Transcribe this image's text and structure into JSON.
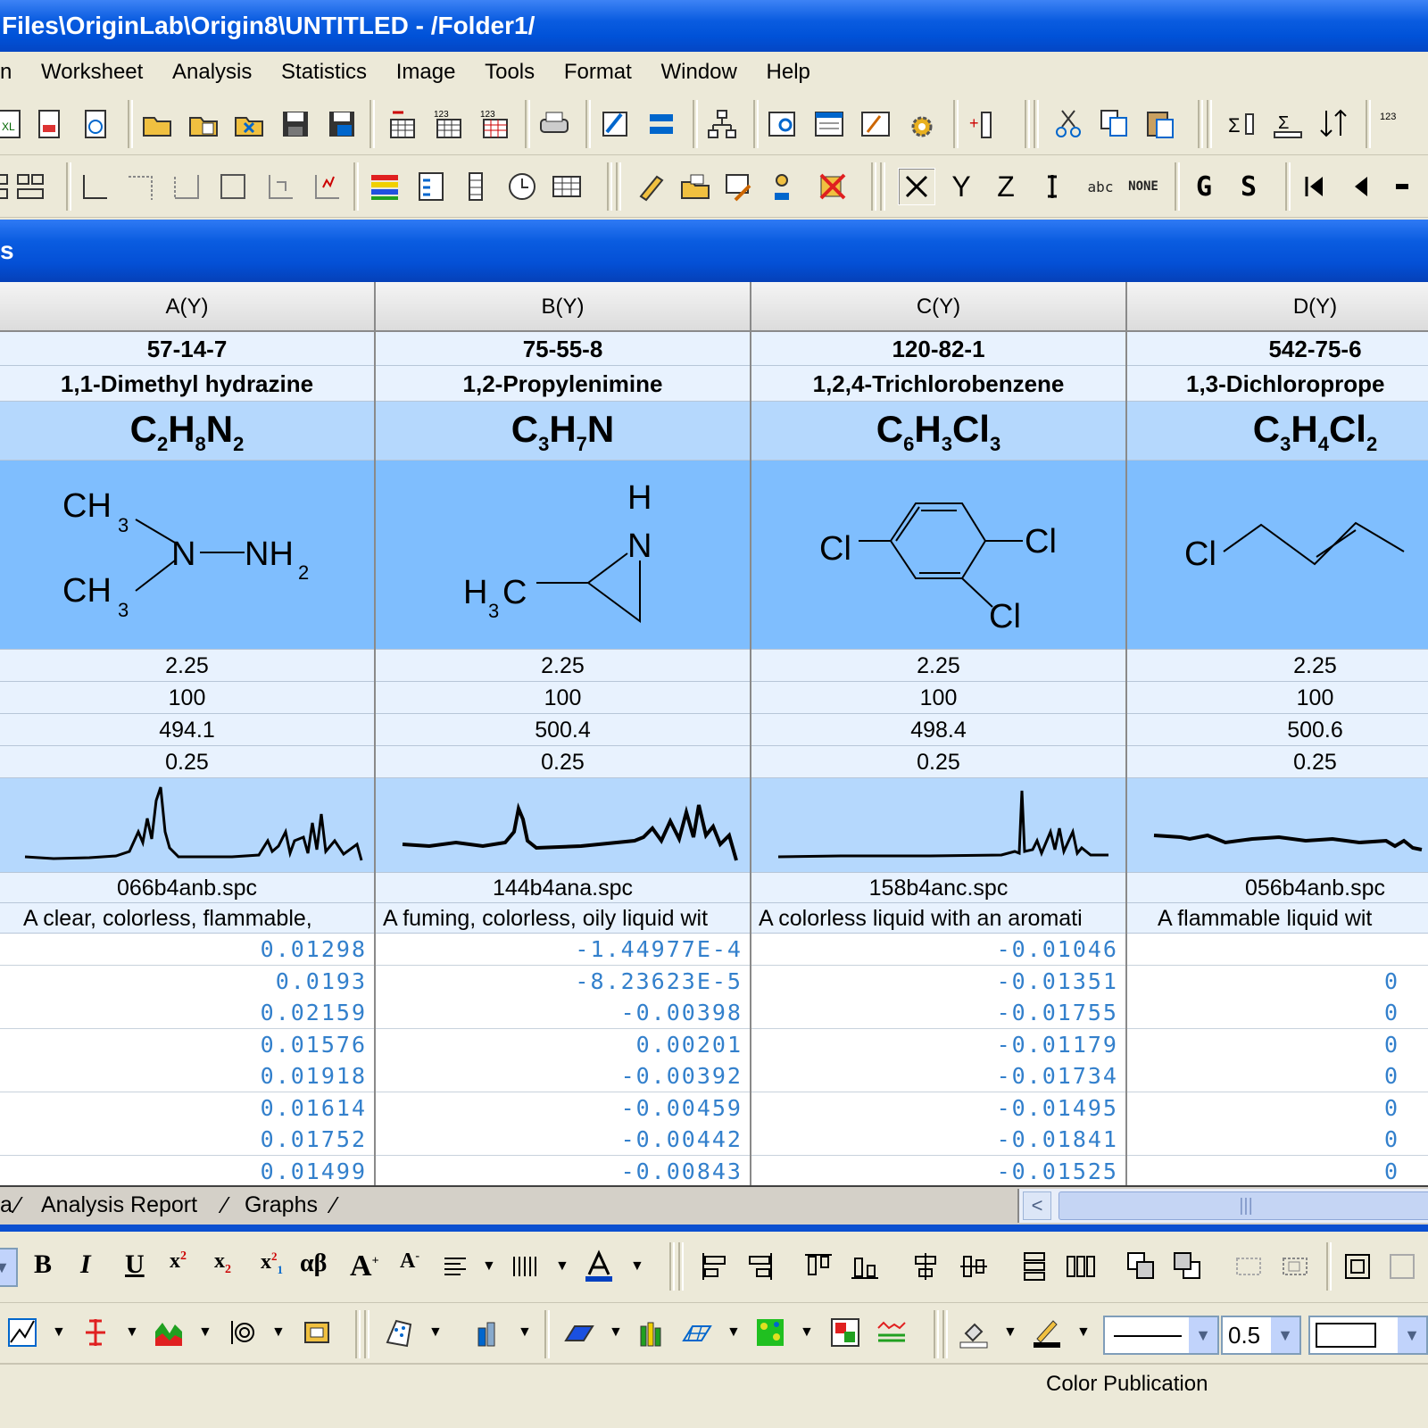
{
  "title": "Files\\OriginLab\\Origin8\\UNTITLED - /Folder1/",
  "menu": [
    "n",
    "Worksheet",
    "Analysis",
    "Statistics",
    "Image",
    "Tools",
    "Format",
    "Window",
    "Help"
  ],
  "window_title": "s",
  "columns": [
    {
      "header": "A(Y)",
      "long_name": "57-14-7",
      "comment": "1,1-Dimethyl hydrazine",
      "formula": [
        "C",
        "2",
        "H",
        "8",
        "N",
        "2"
      ],
      "params": [
        "2.25",
        "100",
        "494.1",
        "0.25"
      ],
      "file": "066b4anb.spc",
      "desc": "A clear, colorless, flammable,",
      "values": [
        "0.01298",
        "0.0193",
        "0.02159",
        "0.01576",
        "0.01918",
        "0.01614",
        "0.01752",
        "0.01499"
      ]
    },
    {
      "header": "B(Y)",
      "long_name": "75-55-8",
      "comment": "1,2-Propylenimine",
      "formula": [
        "C",
        "3",
        "H",
        "7",
        "N",
        ""
      ],
      "params": [
        "2.25",
        "100",
        "500.4",
        "0.25"
      ],
      "file": "144b4ana.spc",
      "desc": "A fuming, colorless, oily liquid wit",
      "values": [
        "-1.44977E-4",
        "-8.23623E-5",
        "-0.00398",
        "0.00201",
        "-0.00392",
        "-0.00459",
        "-0.00442",
        "-0.00843"
      ]
    },
    {
      "header": "C(Y)",
      "long_name": "120-82-1",
      "comment": "1,2,4-Trichlorobenzene",
      "formula": [
        "C",
        "6",
        "H",
        "3",
        "Cl",
        "3"
      ],
      "params": [
        "2.25",
        "100",
        "498.4",
        "0.25"
      ],
      "file": "158b4anc.spc",
      "desc": "A colorless liquid with an aromati",
      "values": [
        "-0.01046",
        "-0.01351",
        "-0.01755",
        "-0.01179",
        "-0.01734",
        "-0.01495",
        "-0.01841",
        "-0.01525"
      ]
    },
    {
      "header": "D(Y)",
      "long_name": "542-75-6",
      "comment": "1,3-Dichloroprope",
      "formula": [
        "C",
        "3",
        "H",
        "4",
        "Cl",
        "2"
      ],
      "params": [
        "2.25",
        "100",
        "500.6",
        "0.25"
      ],
      "file": "056b4anb.spc",
      "desc": "A flammable liquid wit",
      "values": [
        "",
        "0",
        "0",
        "0",
        "0",
        "0",
        "0",
        "0"
      ]
    }
  ],
  "structures": {
    "a": {
      "ch3_top": "CH",
      "ch3_top_sub": "3",
      "n": "N",
      "nh2": "NH",
      "nh2_sub": "2",
      "ch3_bot": "CH",
      "ch3_bot_sub": "3"
    },
    "b": {
      "h": "H",
      "n": "N",
      "h3c": "H",
      "h3c_sub": "3",
      "h3c_c": "C"
    },
    "c": {
      "cl_left": "Cl",
      "cl_right": "Cl",
      "cl_bottom": "Cl"
    },
    "d": {
      "cl": "Cl"
    }
  },
  "sheet_tabs": [
    "a",
    "Analysis Report",
    "Graphs"
  ],
  "toolbar2_letters": [
    "Y",
    "Z",
    "G",
    "S"
  ],
  "toolbar2_labels": {
    "abc": "abc",
    "none": "NONE"
  },
  "format": {
    "bold": "B",
    "italic": "I",
    "underline": "U",
    "greek": "αβ",
    "line_width": "0.5"
  },
  "status": "Color Publication",
  "accent_colors": {
    "title_blue": "#0a5ce0",
    "column_label_bg": "#e8f2fe",
    "formula_bg": "#b5d8fd",
    "structure_bg": "#7fbefe",
    "data_text": "#3380cc"
  }
}
